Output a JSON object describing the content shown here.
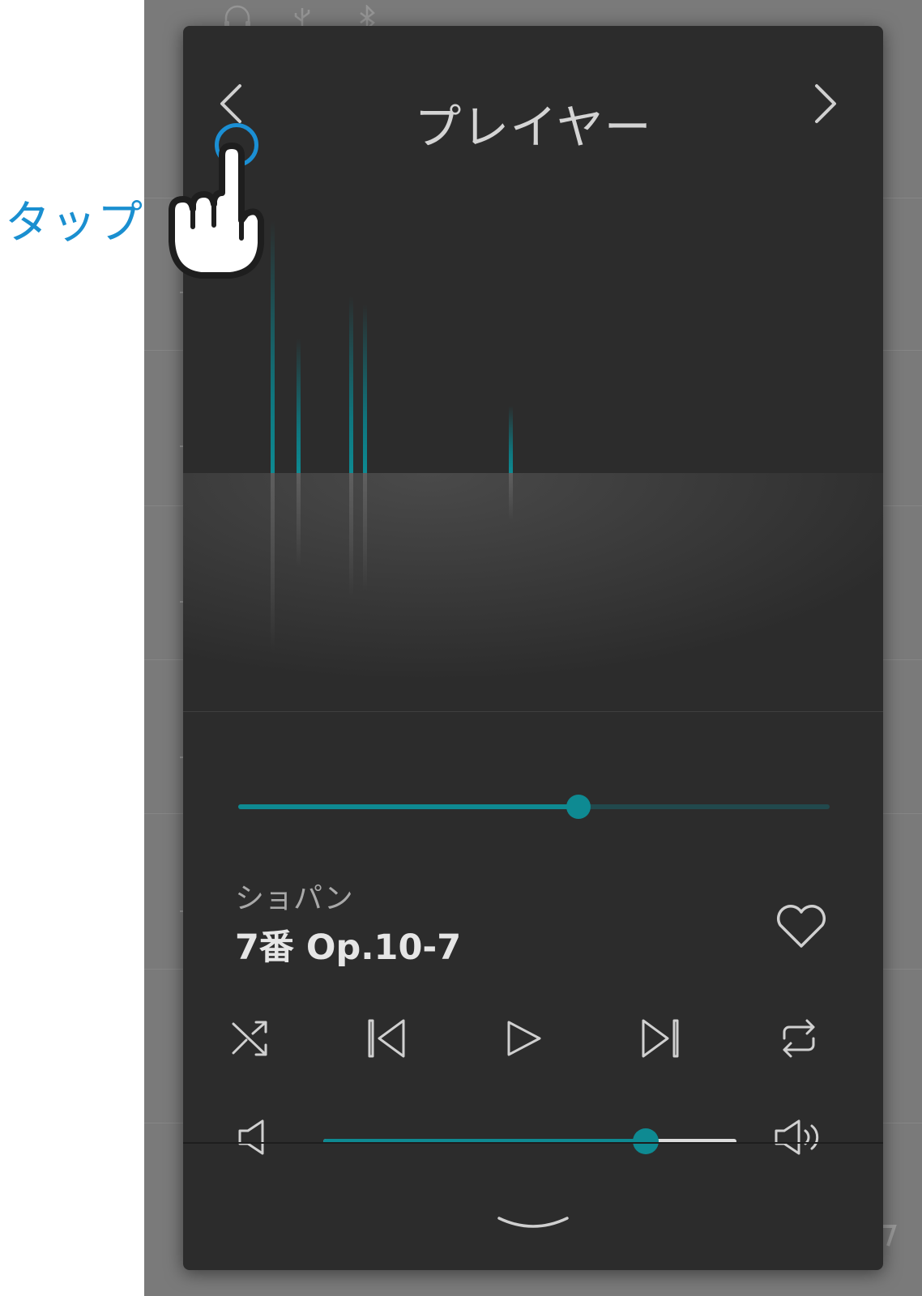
{
  "callout": {
    "label": "タップ"
  },
  "player": {
    "title": "プレイヤー",
    "artist": "ショパン",
    "track": "7番 Op.10-7",
    "progress": 0.575,
    "volume": 0.78
  },
  "icons": {
    "prev": "chevron-left-icon",
    "next": "chevron-right-icon",
    "favorite": "heart-icon",
    "shuffle": "shuffle-icon",
    "skip_back": "skip-back-icon",
    "play": "play-icon",
    "skip_forward": "skip-forward-icon",
    "repeat": "repeat-icon",
    "volume_down": "speaker-icon",
    "volume_up": "speaker-loud-icon",
    "collapse": "chevron-down-icon"
  },
  "colors": {
    "accent": "#0e8a92",
    "panel": "#2c2c2c",
    "callout": "#1a8fd0",
    "track_inactive": "#21494d"
  },
  "visualizer": {
    "bars": [
      0.6,
      0.32,
      0.42,
      0.4,
      0.16
    ]
  }
}
